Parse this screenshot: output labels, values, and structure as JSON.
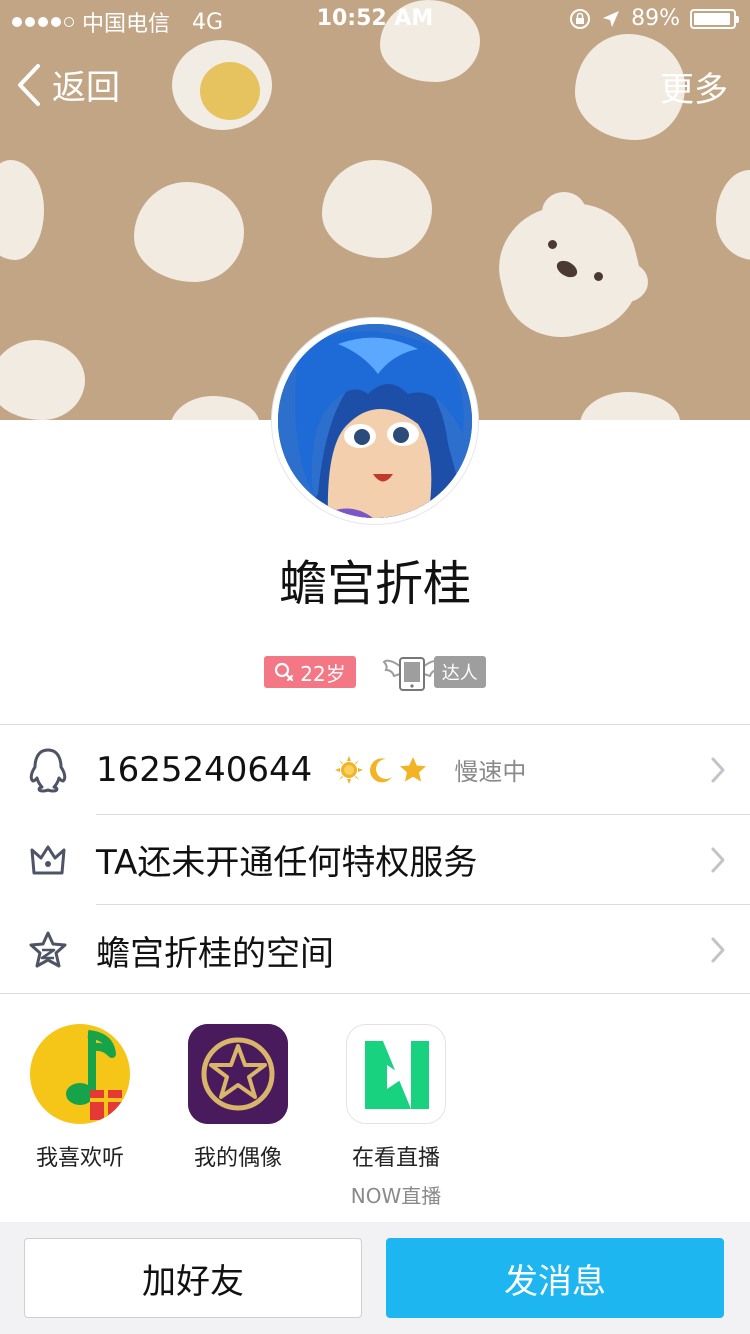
{
  "status_bar": {
    "carrier": "中国电信",
    "network": "4G",
    "time": "10:52 AM",
    "battery": "89%"
  },
  "nav": {
    "back_label": "返回",
    "more_label": "更多"
  },
  "profile": {
    "nickname": "蟾宫折桂",
    "age_badge": "22岁",
    "daren_badge": "达人"
  },
  "list": {
    "qq_number": "1625240644",
    "qq_status": "慢速中",
    "privilege": "TA还未开通任何特权服务",
    "space": "蟾宫折桂的空间"
  },
  "apps": [
    {
      "label": "我喜欢听",
      "sub": ""
    },
    {
      "label": "我的偶像",
      "sub": ""
    },
    {
      "label": "在看直播",
      "sub": "NOW直播"
    }
  ],
  "actions": {
    "add_friend": "加好友",
    "send_message": "发消息"
  },
  "colors": {
    "banner": "#c2a585",
    "accent": "#1eb6f0",
    "age_badge": "#f47786"
  }
}
